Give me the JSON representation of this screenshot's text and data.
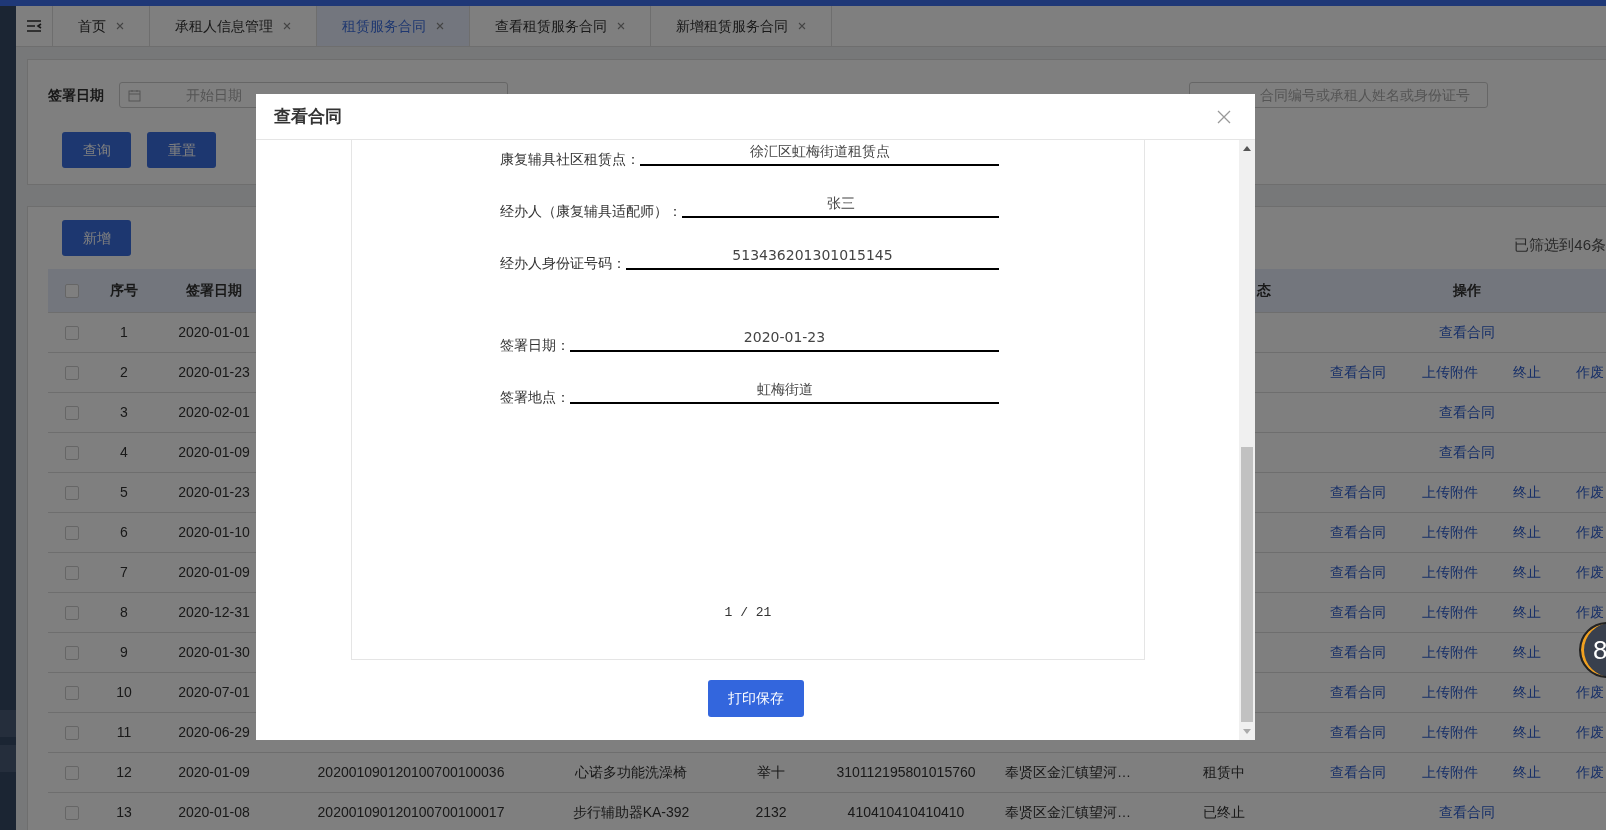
{
  "tabs": [
    {
      "label": "首页",
      "selected": false
    },
    {
      "label": "承租人信息管理",
      "selected": false
    },
    {
      "label": "租赁服务合同",
      "selected": true
    },
    {
      "label": "查看租赁服务合同",
      "selected": false
    },
    {
      "label": "新增租赁服务合同",
      "selected": false
    }
  ],
  "filters": {
    "date_label": "签署日期",
    "date_placeholder": "开始日期",
    "keyword_placeholder": "合同编号或承租人姓名或身份证号",
    "buttons": [
      "查询",
      "重置"
    ]
  },
  "list": {
    "add_button": "新增",
    "count_text": "已筛选到46条",
    "table": {
      "all_checked": false,
      "columns": {
        "no": "序号",
        "date": "签署日期",
        "status": "态",
        "actions": "操作"
      },
      "rows": [
        {
          "checked": false,
          "no": "1",
          "date": "2020-01-01",
          "actions": [
            "查看合同"
          ]
        },
        {
          "checked": false,
          "no": "2",
          "date": "2020-01-23",
          "actions": [
            "查看合同",
            "上传附件",
            "终止",
            "作废"
          ]
        },
        {
          "checked": false,
          "no": "3",
          "date": "2020-02-01",
          "actions": [
            "查看合同"
          ]
        },
        {
          "checked": false,
          "no": "4",
          "date": "2020-01-09",
          "actions": [
            "查看合同"
          ]
        },
        {
          "checked": false,
          "no": "5",
          "date": "2020-01-23",
          "actions": [
            "查看合同",
            "上传附件",
            "终止",
            "作废"
          ]
        },
        {
          "checked": false,
          "no": "6",
          "date": "2020-01-10",
          "actions": [
            "查看合同",
            "上传附件",
            "终止",
            "作废"
          ]
        },
        {
          "checked": false,
          "no": "7",
          "date": "2020-01-09",
          "actions": [
            "查看合同",
            "上传附件",
            "终止",
            "作废"
          ]
        },
        {
          "checked": false,
          "no": "8",
          "date": "2020-12-31",
          "actions": [
            "查看合同",
            "上传附件",
            "终止",
            "作废"
          ]
        },
        {
          "checked": false,
          "no": "9",
          "date": "2020-01-30",
          "actions": [
            "查看合同",
            "上传附件",
            "终止"
          ]
        },
        {
          "checked": false,
          "no": "10",
          "date": "2020-07-01",
          "actions": [
            "查看合同",
            "上传附件",
            "终止",
            "作废"
          ]
        },
        {
          "checked": false,
          "no": "11",
          "date": "2020-06-29",
          "actions": [
            "查看合同",
            "上传附件",
            "终止",
            "作废"
          ]
        },
        {
          "checked": false,
          "no": "12",
          "date": "2020-01-09",
          "contract_no": "202001090120100700100036",
          "device": "心诺多功能洗澡椅",
          "renter": "举十",
          "id_no": "310112195801015760",
          "address": "奉贤区金汇镇望河…",
          "status": "租赁中",
          "actions": [
            "查看合同",
            "上传附件",
            "终止",
            "作废"
          ]
        },
        {
          "checked": false,
          "no": "13",
          "date": "2020-01-08",
          "contract_no": "202001090120100700100017",
          "device": "步行辅助器KA-392",
          "renter": "2132",
          "id_no": "410410410410410",
          "address": "奉贤区金汇镇望河…",
          "status": "已终止",
          "actions": [
            "查看合同"
          ]
        }
      ]
    }
  },
  "modal": {
    "title": "查看合同",
    "sections": [
      [
        {
          "label": "康复辅具社区租赁点：",
          "value": "徐汇区虹梅街道租赁点"
        },
        {
          "label": "经办人（康复辅具适配师）：",
          "value": "张三"
        },
        {
          "label": "经办人身份证号码：",
          "value": "513436201301015145"
        }
      ],
      [
        {
          "label": "签署日期：",
          "value": "2020-01-23"
        },
        {
          "label": "签署地点：",
          "value": "虹梅街道"
        }
      ]
    ],
    "page_number": "1 / 21",
    "print_button": "打印保存"
  },
  "floating_ball": {
    "text": "8"
  }
}
